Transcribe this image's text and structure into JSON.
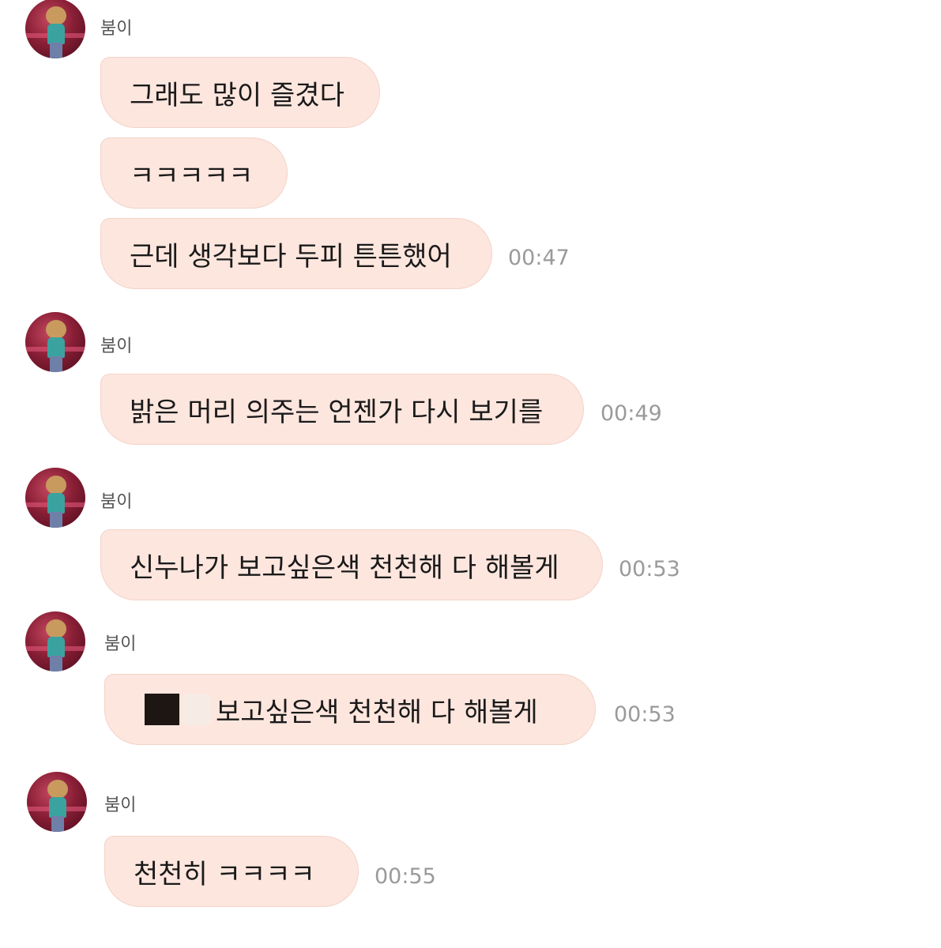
{
  "sender_name": "붐이",
  "messages": [
    {
      "text": "그래도 많이 즐겼다"
    },
    {
      "text": "ㅋㅋㅋㅋㅋ"
    },
    {
      "text": "근데 생각보다 두피 튼튼했어",
      "time": "00:47"
    },
    {
      "text": "밝은 머리 의주는 언젠가 다시 보기를",
      "time": "00:49"
    },
    {
      "text": "신누나가 보고싶은색 천천해 다 해볼게",
      "time": "00:53"
    },
    {
      "text": "보고싶은색 천천해 다 해볼게",
      "time": "00:53"
    },
    {
      "text": "천천히 ㅋㅋㅋㅋ",
      "time": "00:55"
    }
  ],
  "colors": {
    "bubble_fill": "#fde6de",
    "bubble_border": "#f3d3c8",
    "timestamp": "#9a9a9a"
  }
}
